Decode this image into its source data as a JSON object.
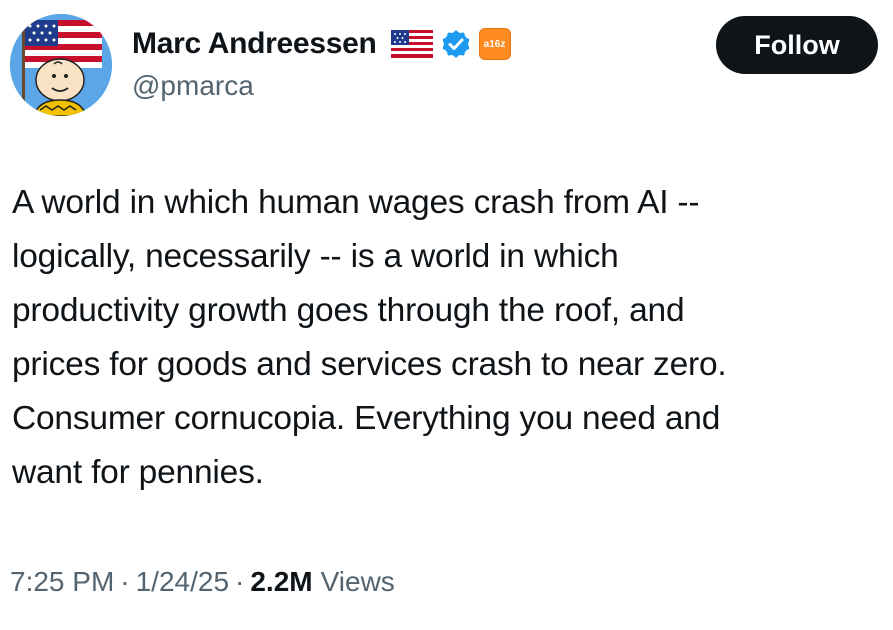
{
  "author": {
    "display_name": "Marc Andreessen",
    "handle": "@pmarca",
    "badges": [
      "us-flag-icon",
      "verified-icon",
      "a16z-affiliate-badge"
    ],
    "affiliate_label": "a16z"
  },
  "follow_button": {
    "label": "Follow"
  },
  "tweet": {
    "lines": [
      "A world in which human wages crash from AI --",
      "logically, necessarily -- is a world in which",
      "productivity growth goes through the roof, and",
      "prices for goods and services crash to near zero.",
      "Consumer cornucopia. Everything you need and",
      "want for pennies."
    ]
  },
  "meta": {
    "time": "7:25 PM",
    "separator": "·",
    "date": "1/24/25",
    "views_count": "2.2M",
    "views_label": "Views"
  },
  "colors": {
    "text_primary": "#0f1419",
    "text_secondary": "#536471",
    "verified_blue": "#1d9bf0",
    "affiliate_orange": "#ff8a1f",
    "follow_bg": "#0f1419"
  }
}
